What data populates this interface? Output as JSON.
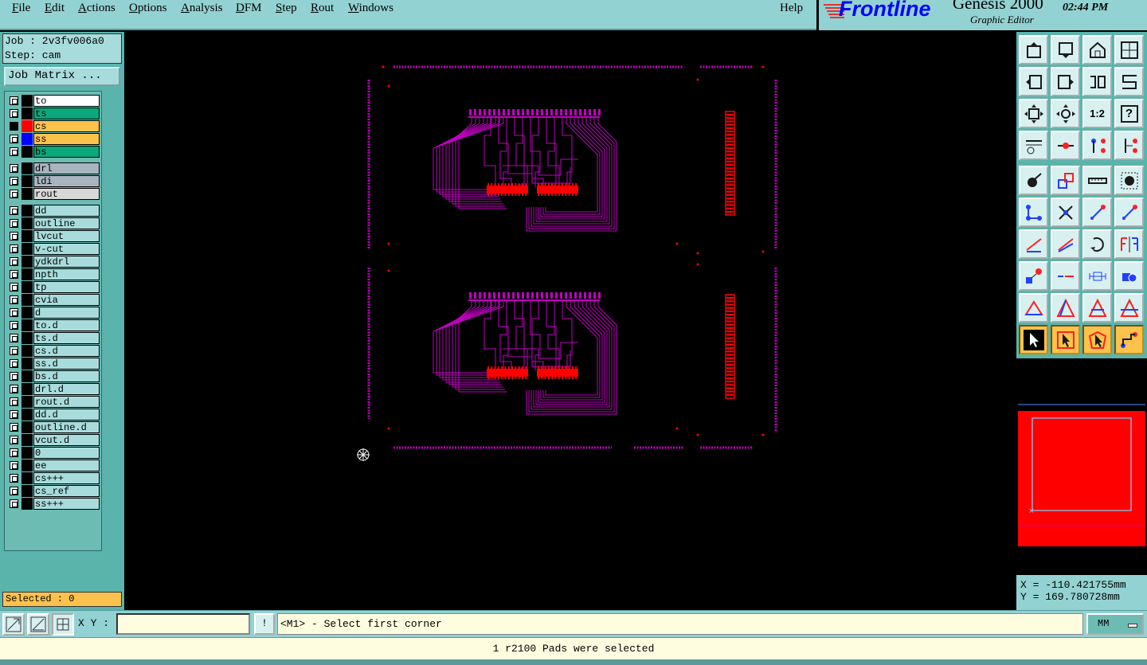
{
  "menubar": {
    "items": [
      {
        "label": "File",
        "mn": "F",
        "rest": "ile"
      },
      {
        "label": "Edit",
        "mn": "E",
        "rest": "dit"
      },
      {
        "label": "Actions",
        "mn": "A",
        "rest": "ctions"
      },
      {
        "label": "Options",
        "mn": "O",
        "rest": "ptions"
      },
      {
        "label": "Analysis",
        "mn": "A",
        "rest": "nalysis"
      },
      {
        "label": "DFM",
        "mn": "D",
        "rest": "FM"
      },
      {
        "label": "Step",
        "mn": "S",
        "rest": "tep"
      },
      {
        "label": "Rout",
        "mn": "R",
        "rest": "out"
      },
      {
        "label": "Windows",
        "mn": "W",
        "rest": "indows"
      }
    ],
    "help": "Help"
  },
  "brand": {
    "name": "Frontline",
    "product": "Genesis 2000",
    "subtitle": "Graphic Editor",
    "clock": "02:44 PM",
    "brand_color": "#0000ff"
  },
  "job": {
    "job_line": "Job : 2v3fv006a0",
    "step_line": "Step: cam",
    "matrix_button": "Job Matrix ..."
  },
  "layers": [
    {
      "name": "to",
      "bg": "#ffffff",
      "swatch": "#000000",
      "group": 0
    },
    {
      "name": "ts",
      "bg": "#0aa87a",
      "swatch": "#000000",
      "group": 0
    },
    {
      "name": "cs",
      "bg": "#fcc24c",
      "swatch": "#ff0000",
      "group": 0,
      "active": true
    },
    {
      "name": "ss",
      "bg": "#fcc24c",
      "swatch": "#0000ff",
      "group": 0
    },
    {
      "name": "bs",
      "bg": "#0aa87a",
      "swatch": "#000000",
      "group": 0
    },
    {
      "name": "drl",
      "bg": "#a8b4c0",
      "swatch": "#000000",
      "group": 1
    },
    {
      "name": "ldi",
      "bg": "#a8b4c0",
      "swatch": "#000000",
      "group": 1
    },
    {
      "name": "rout",
      "bg": "#d8d8d8",
      "swatch": "#000000",
      "group": 1
    },
    {
      "name": "dd",
      "bg": "#a8dcdc",
      "swatch": "#000000",
      "group": 2
    },
    {
      "name": "outline",
      "bg": "#a8dcdc",
      "swatch": "#000000",
      "group": 2
    },
    {
      "name": "lvcut",
      "bg": "#a8dcdc",
      "swatch": "#000000",
      "group": 2
    },
    {
      "name": "v-cut",
      "bg": "#a8dcdc",
      "swatch": "#000000",
      "group": 2
    },
    {
      "name": "ydkdrl",
      "bg": "#a8dcdc",
      "swatch": "#000000",
      "group": 2
    },
    {
      "name": "npth",
      "bg": "#a8dcdc",
      "swatch": "#000000",
      "group": 2
    },
    {
      "name": "tp",
      "bg": "#a8dcdc",
      "swatch": "#000000",
      "group": 2
    },
    {
      "name": "cvia",
      "bg": "#a8dcdc",
      "swatch": "#000000",
      "group": 2
    },
    {
      "name": "d",
      "bg": "#a8dcdc",
      "swatch": "#000000",
      "group": 2
    },
    {
      "name": "to.d",
      "bg": "#a8dcdc",
      "swatch": "#000000",
      "group": 2
    },
    {
      "name": "ts.d",
      "bg": "#a8dcdc",
      "swatch": "#000000",
      "group": 2
    },
    {
      "name": "cs.d",
      "bg": "#a8dcdc",
      "swatch": "#000000",
      "group": 2
    },
    {
      "name": "ss.d",
      "bg": "#a8dcdc",
      "swatch": "#000000",
      "group": 2
    },
    {
      "name": "bs.d",
      "bg": "#a8dcdc",
      "swatch": "#000000",
      "group": 2
    },
    {
      "name": "drl.d",
      "bg": "#a8dcdc",
      "swatch": "#000000",
      "group": 2
    },
    {
      "name": "rout.d",
      "bg": "#a8dcdc",
      "swatch": "#000000",
      "group": 2
    },
    {
      "name": "dd.d",
      "bg": "#a8dcdc",
      "swatch": "#000000",
      "group": 2
    },
    {
      "name": "outline.d",
      "bg": "#a8dcdc",
      "swatch": "#000000",
      "group": 2
    },
    {
      "name": "vcut.d",
      "bg": "#a8dcdc",
      "swatch": "#000000",
      "group": 2
    },
    {
      "name": "0",
      "bg": "#a8dcdc",
      "swatch": "#000000",
      "group": 2
    },
    {
      "name": "ee",
      "bg": "#a8dcdc",
      "swatch": "#000000",
      "group": 2
    },
    {
      "name": "cs+++",
      "bg": "#a8dcdc",
      "swatch": "#000000",
      "group": 2
    },
    {
      "name": "cs_ref",
      "bg": "#a8dcdc",
      "swatch": "#000000",
      "group": 2
    },
    {
      "name": "ss+++",
      "bg": "#a8dcdc",
      "swatch": "#000000",
      "group": 2
    }
  ],
  "selected": "Selected : 0",
  "toolbar": {
    "rows": [
      [
        "open-step-icon",
        "save-icon",
        "home-icon",
        "window-layout-icon"
      ],
      [
        "undo-arrow-icon",
        "redo-arrow-icon",
        "zoom-back-icon",
        "zoom-forward-icon"
      ],
      [
        "fit-screen-icon",
        "pan-icon",
        "ratio-icon",
        "query-icon"
      ],
      [
        "settings-icon",
        "snap-icon",
        "netlist-icon",
        "netlist-compare-icon"
      ],
      [
        "add-pad-icon",
        "add-surface-icon",
        "measure-icon",
        "pad-circle-icon"
      ],
      [
        "connect-icon",
        "cross-icon",
        "line-end-icon",
        "line-end2-icon"
      ],
      [
        "angle-icon",
        "slope-icon",
        "rotate-icon",
        "mirror-icon"
      ],
      [
        "add-feature-icon",
        "dash-icon",
        "dimension-icon",
        "group-icon"
      ],
      [
        "triangle-icon",
        "a-triangle-icon",
        "a-triangle2-icon",
        "a-triangle3-icon"
      ],
      [
        "select-arrow-icon",
        "select-box-icon",
        "select-polygon-icon",
        "select-net-icon"
      ]
    ],
    "ratio_label": "1:2",
    "query_label": "?"
  },
  "coords": {
    "x": "X = -110.421755mm",
    "y": "Y = 169.780728mm"
  },
  "bottom": {
    "xy_label": "X Y :",
    "xy_value": "",
    "excl": "!",
    "prompt": "<M1> - Select first corner",
    "units": "MM"
  },
  "status": "1 r2100 Pads were selected",
  "colors": {
    "layer_trace": "#c000c0",
    "layer_active": "#ff0000",
    "panel_bg": "#5ab4ac",
    "menu_bg": "#93d2d2",
    "highlight": "#fcc24c"
  }
}
